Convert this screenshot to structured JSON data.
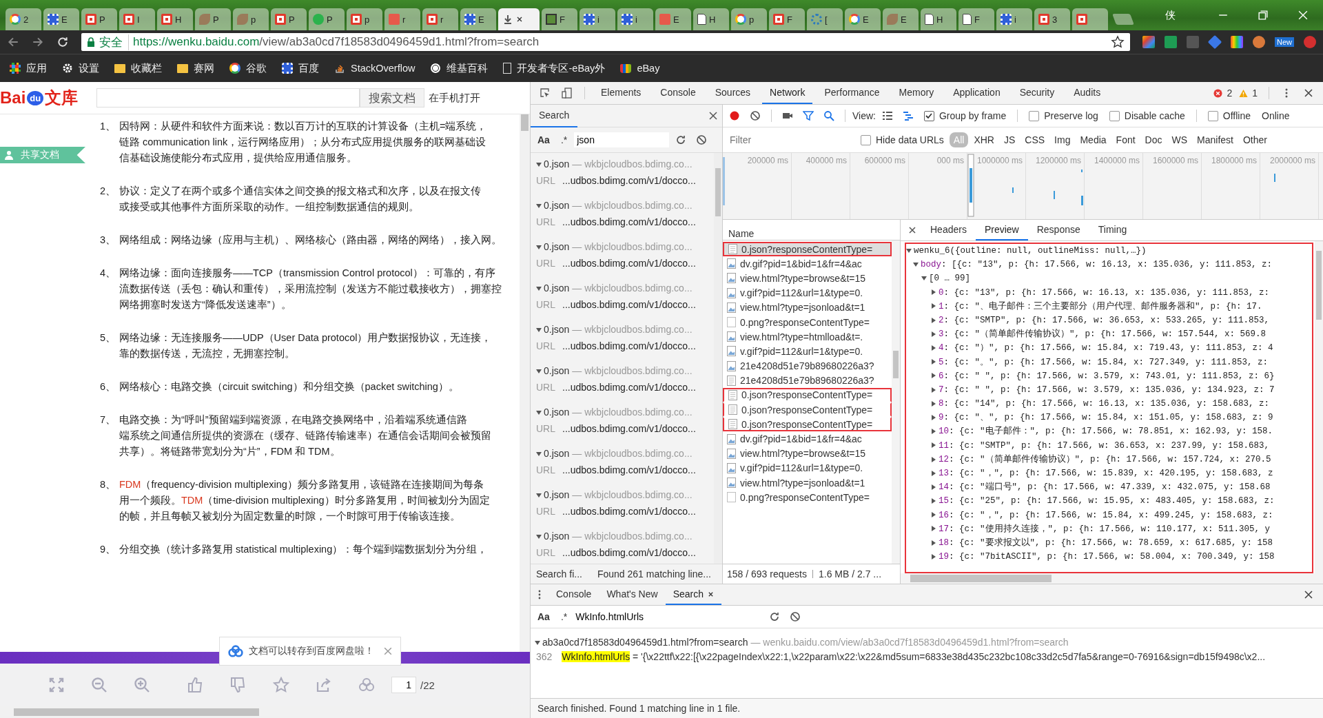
{
  "browser": {
    "tabs": [
      {
        "kind": "google",
        "label": "2",
        "selected": false
      },
      {
        "kind": "baidu",
        "label": "E",
        "selected": false
      },
      {
        "kind": "csdn",
        "label": "P",
        "selected": false
      },
      {
        "kind": "csdn",
        "label": "I",
        "selected": false
      },
      {
        "kind": "csdn",
        "label": "H",
        "selected": false
      },
      {
        "kind": "generic",
        "label": "P",
        "selected": false
      },
      {
        "kind": "generic",
        "label": "p",
        "selected": false
      },
      {
        "kind": "csdn",
        "label": "P",
        "selected": false
      },
      {
        "kind": "green",
        "label": "P",
        "selected": false
      },
      {
        "kind": "csdn",
        "label": "p",
        "selected": false
      },
      {
        "kind": "jian",
        "label": "r",
        "selected": false
      },
      {
        "kind": "csdn",
        "label": "r",
        "selected": false
      },
      {
        "kind": "baidu",
        "label": "E",
        "selected": false
      },
      {
        "kind": "download",
        "selected": true
      },
      {
        "kind": "terminal",
        "label": "F",
        "selected": false
      },
      {
        "kind": "baidu",
        "label": "i",
        "selected": false
      },
      {
        "kind": "baidu",
        "label": "i",
        "selected": false
      },
      {
        "kind": "jian",
        "label": "E",
        "selected": false
      },
      {
        "kind": "page",
        "label": "H",
        "selected": false
      },
      {
        "kind": "google",
        "label": "p",
        "selected": false
      },
      {
        "kind": "csdn",
        "label": "F",
        "selected": false
      },
      {
        "kind": "snow",
        "label": "[",
        "selected": false
      },
      {
        "kind": "google",
        "label": "E",
        "selected": false
      },
      {
        "kind": "generic",
        "label": "E",
        "selected": false
      },
      {
        "kind": "page",
        "label": "H",
        "selected": false
      },
      {
        "kind": "page",
        "label": "F",
        "selected": false
      },
      {
        "kind": "baidu",
        "label": "i",
        "selected": false
      },
      {
        "kind": "csdn",
        "label": "3",
        "selected": false
      },
      {
        "kind": "csdn",
        "selected": false
      }
    ],
    "profile_name": "侠",
    "address": {
      "secure_label": "安全",
      "url_host": "https://wenku.baidu.com",
      "url_path": "/view/ab3a0cd7f18583d0496459d1.html?from=search"
    },
    "extension_badge": "New",
    "bookmarks": [
      {
        "kind": "apps",
        "label": "应用"
      },
      {
        "kind": "gear",
        "label": "设置"
      },
      {
        "kind": "folder",
        "label": "收藏栏"
      },
      {
        "kind": "folder",
        "label": "赛网"
      },
      {
        "kind": "google",
        "label": "谷歌"
      },
      {
        "kind": "baidu",
        "label": "百度"
      },
      {
        "kind": "stack",
        "label": "StackOverflow"
      },
      {
        "kind": "wiki",
        "label": "维基百科"
      },
      {
        "kind": "page",
        "label": "开发者专区-eBay外"
      },
      {
        "kind": "ebay",
        "label": "eBay"
      }
    ]
  },
  "document": {
    "logo": {
      "part1": "Bai",
      "part2": "du",
      "part3": "文库"
    },
    "search_button": "搜索文档",
    "mobile_link": "在手机打开",
    "side_tag": "共享文档",
    "paragraphs": [
      {
        "number": "1、",
        "lines": [
          [
            {
              "text": "因特网：从硬件和软件方面来说：数以百万计的互联的计算设备（主机=端系统，",
              "highlight": false
            }
          ],
          [
            {
              "text": "链路 communication link，运行网络应用）；从分布式应用提供服务的联网基础设",
              "highlight": false
            }
          ],
          [
            {
              "text": "信基础设施使能分布式应用，提供给应用通信服务。",
              "highlight": false
            }
          ]
        ]
      },
      {
        "number": "2、",
        "lines": [
          [
            {
              "text": "协议：定义了在两个或多个通信实体之间交换的报文格式和次序，以及在报文传",
              "highlight": false
            }
          ],
          [
            {
              "text": "或接受或其他事件方面所采取的动作。一组控制数据通信的规则。",
              "highlight": false
            }
          ]
        ]
      },
      {
        "number": "3、",
        "lines": [
          [
            {
              "text": "网络组成：网络边缘（应用与主机）、网络核心（路由器，网络的网络），接入网。",
              "highlight": false
            }
          ]
        ]
      },
      {
        "number": "4、",
        "lines": [
          [
            {
              "text": "网络边缘：面向连接服务——TCP（transmission Control protocol）：可靠的，有序",
              "highlight": false
            }
          ],
          [
            {
              "text": "流数据传送（丢包：确认和重传），采用流控制（发送方不能过载接收方），拥塞控",
              "highlight": false
            }
          ],
          [
            {
              "text": "网络拥塞时发送方“降低发送速率”）。",
              "highlight": false
            }
          ]
        ]
      },
      {
        "number": "5、",
        "lines": [
          [
            {
              "text": "网络边缘：无连接服务——UDP（User Data protocol）用户数据报协议，无连接，",
              "highlight": false
            }
          ],
          [
            {
              "text": "靠的数据传送，无流控，无拥塞控制。",
              "highlight": false
            }
          ]
        ]
      },
      {
        "number": "6、",
        "lines": [
          [
            {
              "text": "网络核心：电路交换（circuit switching）和分组交换（packet switching）。",
              "highlight": false
            }
          ]
        ]
      },
      {
        "number": "7、",
        "lines": [
          [
            {
              "text": "电路交换：为“呼叫”预留端到端资源，在电路交换网络中，沿着端系统通信路",
              "highlight": false
            }
          ],
          [
            {
              "text": "端系统之间通信所提供的资源在（缓存、链路传输速率）在通信会话期间会被预留",
              "highlight": false
            }
          ],
          [
            {
              "text": "共享）。将链路带宽划分为“片”，FDM 和 TDM。",
              "highlight": false
            }
          ]
        ]
      },
      {
        "number": "8、",
        "lines": [
          [
            {
              "text": "FDM",
              "highlight": true
            },
            {
              "text": "（frequency-division multiplexing）频分多路复用，该链路在连接期间为每条",
              "highlight": false
            }
          ],
          [
            {
              "text": "用一个频段。",
              "highlight": false
            },
            {
              "text": "TDM",
              "highlight": true
            },
            {
              "text": "（time-division multiplexing）时分多路复用，时间被划分为固定",
              "highlight": false
            }
          ],
          [
            {
              "text": "的帧，并且每帧又被划分为固定数量的时隙，一个时隙可用于传输该连接。",
              "highlight": false
            }
          ]
        ]
      },
      {
        "number": "9、",
        "lines": [
          [
            {
              "text": "分组交换（统计多路复用 statistical multiplexing）：每个端到端数据划分为分组，",
              "highlight": false
            }
          ]
        ]
      }
    ],
    "toast": "文档可以转存到百度网盘啦！",
    "page_input": "1",
    "page_total": "/22"
  },
  "devtools": {
    "tabs": [
      {
        "label": "Elements",
        "selected": false
      },
      {
        "label": "Console",
        "selected": false
      },
      {
        "label": "Sources",
        "selected": false
      },
      {
        "label": "Network",
        "selected": true
      },
      {
        "label": "Performance",
        "selected": false
      },
      {
        "label": "Memory",
        "selected": false
      },
      {
        "label": "Application",
        "selected": false
      },
      {
        "label": "Security",
        "selected": false
      },
      {
        "label": "Audits",
        "selected": false
      }
    ],
    "error_count": "2",
    "warning_count": "1",
    "search_panel": {
      "title": "Search",
      "case_toggle": "Aa",
      "regex_toggle": ".*",
      "query": "json",
      "results": [
        {
          "file": "0.json",
          "host": "— wkbjcloudbos.bdimg.co...",
          "url_label": "URL",
          "url": "...udbos.bdimg.com/v1/docco..."
        },
        {
          "file": "0.json",
          "host": "— wkbjcloudbos.bdimg.co...",
          "url_label": "URL",
          "url": "...udbos.bdimg.com/v1/docco..."
        },
        {
          "file": "0.json",
          "host": "— wkbjcloudbos.bdimg.co...",
          "url_label": "URL",
          "url": "...udbos.bdimg.com/v1/docco..."
        },
        {
          "file": "0.json",
          "host": "— wkbjcloudbos.bdimg.co...",
          "url_label": "URL",
          "url": "...udbos.bdimg.com/v1/docco..."
        },
        {
          "file": "0.json",
          "host": "— wkbjcloudbos.bdimg.co...",
          "url_label": "URL",
          "url": "...udbos.bdimg.com/v1/docco..."
        },
        {
          "file": "0.json",
          "host": "— wkbjcloudbos.bdimg.co...",
          "url_label": "URL",
          "url": "...udbos.bdimg.com/v1/docco..."
        },
        {
          "file": "0.json",
          "host": "— wkbjcloudbos.bdimg.co...",
          "url_label": "URL",
          "url": "...udbos.bdimg.com/v1/docco..."
        },
        {
          "file": "0.json",
          "host": "— wkbjcloudbos.bdimg.co...",
          "url_label": "URL",
          "url": "...udbos.bdimg.com/v1/docco..."
        },
        {
          "file": "0.json",
          "host": "— wkbjcloudbos.bdimg.co...",
          "url_label": "URL",
          "url": "...udbos.bdimg.com/v1/docco..."
        },
        {
          "file": "0.json",
          "host": "— wkbjcloudbos.bdimg.co...",
          "url_label": "URL",
          "url": "...udbos.bdimg.com/v1/docco..."
        }
      ],
      "status": "Search fi...",
      "found": "Found 261 matching line..."
    },
    "network": {
      "view_label": "View:",
      "options": [
        {
          "label": "Group by frame",
          "checked": true
        },
        {
          "label": "Preserve log",
          "checked": false
        },
        {
          "label": "Disable cache",
          "checked": false
        },
        {
          "label": "Offline",
          "checked": false
        }
      ],
      "throttle": "Online",
      "filter_placeholder": "Filter",
      "hide_data_urls": {
        "label": "Hide data URLs",
        "checked": false
      },
      "types": [
        {
          "label": "All",
          "selected": true
        },
        {
          "label": "XHR",
          "selected": false
        },
        {
          "label": "JS",
          "selected": false
        },
        {
          "label": "CSS",
          "selected": false
        },
        {
          "label": "Img",
          "selected": false
        },
        {
          "label": "Media",
          "selected": false
        },
        {
          "label": "Font",
          "selected": false
        },
        {
          "label": "Doc",
          "selected": false
        },
        {
          "label": "WS",
          "selected": false
        },
        {
          "label": "Manifest",
          "selected": false
        },
        {
          "label": "Other",
          "selected": false
        }
      ],
      "timeline_ticks": [
        "200000 ms",
        "400000 ms",
        "600000 ms",
        "000 ms",
        "1000000 ms",
        "1200000 ms",
        "1400000 ms",
        "1600000 ms",
        "1800000 ms",
        "2000000 ms"
      ],
      "name_header": "Name",
      "requests": [
        {
          "name": "0.json?responseContentType=",
          "kind": "doc",
          "selected": true,
          "boxed": true
        },
        {
          "name": "dv.gif?pid=1&bid=1&fr=4&ac",
          "kind": "image",
          "selected": false,
          "boxed": false
        },
        {
          "name": "view.html?type=browse&t=15",
          "kind": "image",
          "selected": false,
          "boxed": false
        },
        {
          "name": "v.gif?pid=112&url=1&type=0.",
          "kind": "image",
          "selected": false,
          "boxed": false
        },
        {
          "name": "view.html?type=jsonload&t=1",
          "kind": "image",
          "selected": false,
          "boxed": false
        },
        {
          "name": "0.png?responseContentType=",
          "kind": "blank",
          "selected": false,
          "boxed": false
        },
        {
          "name": "view.html?type=htmlload&t=.",
          "kind": "image",
          "selected": false,
          "boxed": false
        },
        {
          "name": "v.gif?pid=112&url=1&type=0.",
          "kind": "image",
          "selected": false,
          "boxed": false
        },
        {
          "name": "21e4208d51e79b89680226a3?",
          "kind": "image",
          "selected": false,
          "boxed": false
        },
        {
          "name": "21e4208d51e79b89680226a3?",
          "kind": "doc",
          "selected": false,
          "boxed": false
        },
        {
          "name": "0.json?responseContentType=",
          "kind": "doc",
          "selected": false,
          "boxed": true
        },
        {
          "name": "0.json?responseContentType=",
          "kind": "doc",
          "selected": false,
          "boxed": true
        },
        {
          "name": "0.json?responseContentType=",
          "kind": "doc",
          "selected": false,
          "boxed": true
        },
        {
          "name": "dv.gif?pid=1&bid=1&fr=4&ac",
          "kind": "image",
          "selected": false,
          "boxed": false
        },
        {
          "name": "view.html?type=browse&t=15",
          "kind": "image",
          "selected": false,
          "boxed": false
        },
        {
          "name": "v.gif?pid=112&url=1&type=0.",
          "kind": "image",
          "selected": false,
          "boxed": false
        },
        {
          "name": "view.html?type=jsonload&t=1",
          "kind": "image",
          "selected": false,
          "boxed": false
        },
        {
          "name": "0.png?responseContentType=",
          "kind": "blank",
          "selected": false,
          "boxed": false
        }
      ],
      "summary_requests": "158 / 693 requests",
      "summary_size": "1.6 MB / 2.7 ...",
      "detail_tabs": [
        {
          "label": "Headers",
          "selected": false
        },
        {
          "label": "Preview",
          "selected": true
        },
        {
          "label": "Response",
          "selected": false
        },
        {
          "label": "Timing",
          "selected": false
        }
      ],
      "preview": {
        "annotated": true,
        "root": "wenku_6({outline: null, outlineMiss: null,…})",
        "body_key": "body",
        "body_value": ": [{c: \"13\", p: {h: 17.566, w: 16.13, x: 135.036, y: 111.853, z:",
        "range": "[0 … 99]",
        "items": [
          {
            "index": "0",
            "text": ": {c: \"13\", p: {h: 17.566, w: 16.13, x: 135.036, y: 111.853, z:"
          },
          {
            "index": "1",
            "text": ": {c: \"、电子邮件：三个主要部分（用户代理、邮件服务器和\", p: {h: 17."
          },
          {
            "index": "2",
            "text": ": {c: \"SMTP\", p: {h: 17.566, w: 36.653, x: 533.265, y: 111.853,"
          },
          {
            "index": "3",
            "text": ": {c: \"（简单邮件传输协议）\", p: {h: 17.566, w: 157.544, x: 569.8"
          },
          {
            "index": "4",
            "text": ": {c: \"）\", p: {h: 17.566, w: 15.84, x: 719.43, y: 111.853, z: 4"
          },
          {
            "index": "5",
            "text": ": {c: \"。\", p: {h: 17.566, w: 15.84, x: 727.349, y: 111.853, z:"
          },
          {
            "index": "6",
            "text": ": {c: \" \", p: {h: 17.566, w: 3.579, x: 743.01, y: 111.853, z: 6}"
          },
          {
            "index": "7",
            "text": ": {c: \" \", p: {h: 17.566, w: 3.579, x: 135.036, y: 134.923, z: 7"
          },
          {
            "index": "8",
            "text": ": {c: \"14\", p: {h: 17.566, w: 16.13, x: 135.036, y: 158.683, z:"
          },
          {
            "index": "9",
            "text": ": {c: \"、\", p: {h: 17.566, w: 15.84, x: 151.05, y: 158.683, z: 9"
          },
          {
            "index": "10",
            "text": ": {c: \"电子邮件：\", p: {h: 17.566, w: 78.851, x: 162.93, y: 158."
          },
          {
            "index": "11",
            "text": ": {c: \"SMTP\", p: {h: 17.566, w: 36.653, x: 237.99, y: 158.683,"
          },
          {
            "index": "12",
            "text": ": {c: \"（简单邮件传输协议）\", p: {h: 17.566, w: 157.724, x: 270.5"
          },
          {
            "index": "13",
            "text": ": {c: \"，\", p: {h: 17.566, w: 15.839, x: 420.195, y: 158.683, z"
          },
          {
            "index": "14",
            "text": ": {c: \"端口号\", p: {h: 17.566, w: 47.339, x: 432.075, y: 158.68"
          },
          {
            "index": "15",
            "text": ": {c: \"25\", p: {h: 17.566, w: 15.95, x: 483.405, y: 158.683, z:"
          },
          {
            "index": "16",
            "text": ": {c: \"，\", p: {h: 17.566, w: 15.84, x: 499.245, y: 158.683, z:"
          },
          {
            "index": "17",
            "text": ": {c: \"使用持久连接，\", p: {h: 17.566, w: 110.177, x: 511.305, y"
          },
          {
            "index": "18",
            "text": ": {c: \"要求报文以\", p: {h: 17.566, w: 78.659, x: 617.685, y: 158"
          },
          {
            "index": "19",
            "text": ": {c: \"7bitASCII\", p: {h: 17.566, w: 58.004, x: 700.349, y: 158"
          }
        ]
      }
    },
    "drawer": {
      "tabs": [
        {
          "label": "Console",
          "selected": false,
          "closable": false
        },
        {
          "label": "What's New",
          "selected": false,
          "closable": false
        },
        {
          "label": "Search",
          "selected": true,
          "closable": true
        }
      ],
      "case_toggle": "Aa",
      "regex_toggle": ".*",
      "query": "WkInfo.htmlUrls",
      "result_file": "ab3a0cd7f18583d0496459d1.html?from=search",
      "result_location": "— wenku.baidu.com/view/ab3a0cd7f18583d0496459d1.html?from=search",
      "match_line": "362",
      "match_term": "WkInfo.htmlUrls",
      "match_rest": " = '{\\x22ttf\\x22:[{\\x22pageIndex\\x22:1,\\x22param\\x22:\\x22&md5sum=6833e38d435c232bc108c33d2c5d7fa5&range=0-76916&sign=db15f9498c\\x2...",
      "status": "Search finished.  Found 1 matching line in 1 file."
    }
  }
}
